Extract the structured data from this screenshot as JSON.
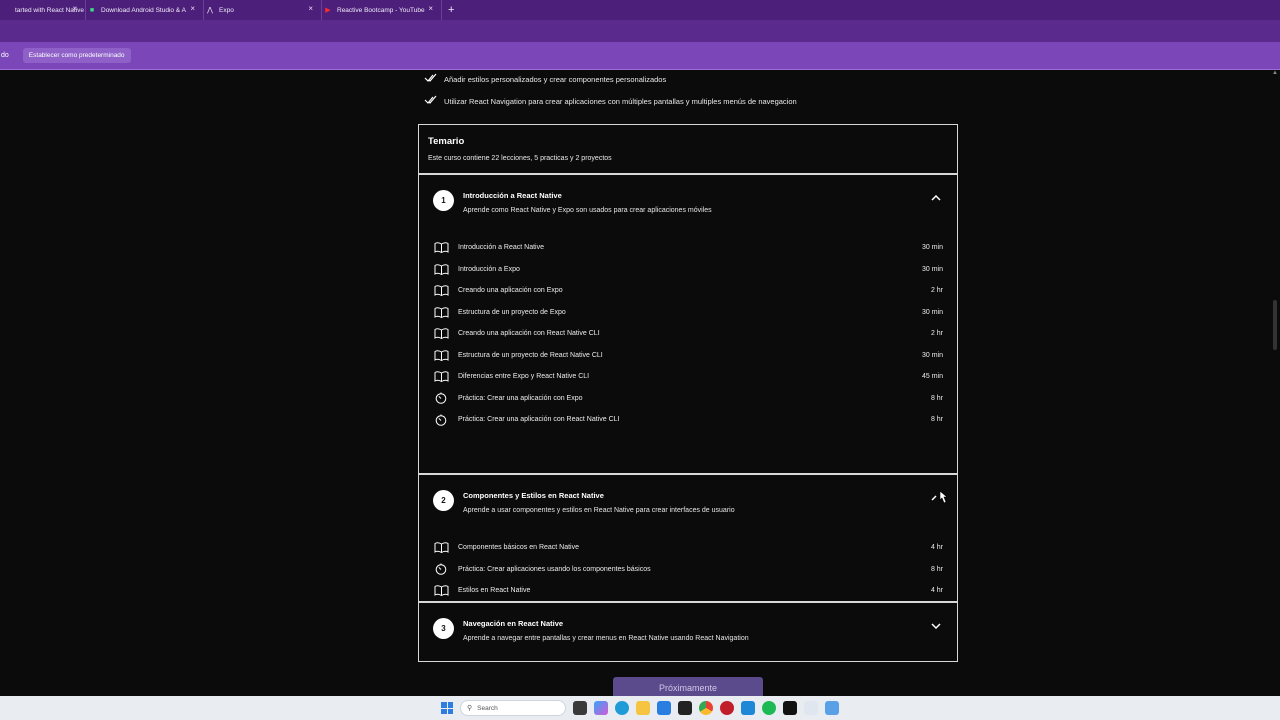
{
  "browser": {
    "tabs": [
      {
        "label": "tarted with React Native",
        "favicon": "react-icon",
        "width": 86
      },
      {
        "label": "Download Android Studio & A",
        "favicon": "android-icon",
        "width": 118
      },
      {
        "label": "Expo",
        "favicon": "expo-icon",
        "width": 118
      },
      {
        "label": "Reactive Bootcamp - YouTube",
        "favicon": "youtube-icon",
        "width": 120
      }
    ],
    "new_tab": "+",
    "close_glyph": "×",
    "infobar_text": "do",
    "infobar_button": "Establecer como predeterminado",
    "accent": "#4b1f7a"
  },
  "benefits": [
    "Añadir estilos personalizados y crear componentes personalizados",
    "Utilizar React Navigation para crear aplicaciones con múltiples pantallas y multiples menús de navegacion"
  ],
  "syllabus": {
    "title": "Temario",
    "summary": "Este curso contiene 22 lecciones, 5 practicas y 2 proyectos"
  },
  "modules": [
    {
      "number": "1",
      "title": "Introducción a React Native",
      "description": "Aprende como React Native y Expo son usados para crear aplicaciones móviles",
      "expanded": true,
      "lessons": [
        {
          "icon": "book-icon",
          "name": "Introducción a React Native",
          "duration": "30 min"
        },
        {
          "icon": "book-icon",
          "name": "Introducción a Expo",
          "duration": "30 min"
        },
        {
          "icon": "book-icon",
          "name": "Creando una aplicación con Expo",
          "duration": "2 hr"
        },
        {
          "icon": "book-icon",
          "name": "Estructura de un proyecto de Expo",
          "duration": "30 min"
        },
        {
          "icon": "book-icon",
          "name": "Creando una aplicación con React Native CLI",
          "duration": "2 hr"
        },
        {
          "icon": "book-icon",
          "name": "Estructura de un proyecto de React Native CLI",
          "duration": "30 min"
        },
        {
          "icon": "book-icon",
          "name": "Diferencias entre Expo y React Native CLI",
          "duration": "45 min"
        },
        {
          "icon": "timer-icon",
          "name": "Práctica: Crear una aplicación con Expo",
          "duration": "8 hr"
        },
        {
          "icon": "timer-icon",
          "name": "Práctica: Crear una aplicación con React Native CLI",
          "duration": "8 hr"
        }
      ]
    },
    {
      "number": "2",
      "title": "Componentes y Estilos en React Native",
      "description": "Aprende a usar componentes y estilos en React Native para crear interfaces de usuario",
      "expanded": true,
      "lessons": [
        {
          "icon": "book-icon",
          "name": "Componentes básicos en React Native",
          "duration": "4 hr"
        },
        {
          "icon": "timer-icon",
          "name": "Práctica: Crear aplicaciones usando los componentes básicos",
          "duration": "8 hr"
        },
        {
          "icon": "book-icon",
          "name": "Estilos en React Native",
          "duration": "4 hr"
        }
      ]
    },
    {
      "number": "3",
      "title": "Navegación en React Native",
      "description": "Aprende a navegar entre pantallas y crear menus en React Native usando React Navigation",
      "expanded": false,
      "lessons": []
    }
  ],
  "cta_label": "Próximamente",
  "taskbar": {
    "search_placeholder": "Search"
  }
}
